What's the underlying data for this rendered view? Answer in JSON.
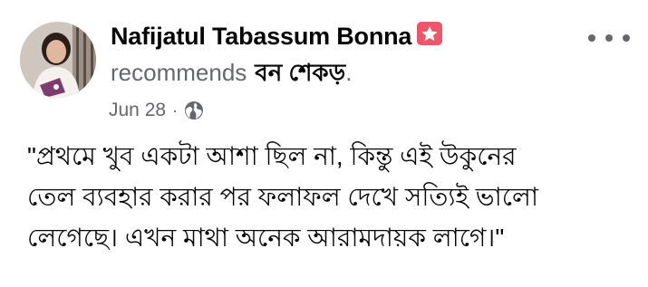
{
  "author": {
    "name": "Nafijatul Tabassum Bonna",
    "avatar": "profile-photo"
  },
  "recommendation": {
    "verb": "recommends",
    "page_name": "বন শেকড়",
    "period": "."
  },
  "meta": {
    "date": "Jun 28",
    "separator": "·",
    "privacy_icon": "globe-icon"
  },
  "more_icon": "more-options-icon",
  "badge_icon": "star-badge-icon",
  "colors": {
    "badge": "#f0566b",
    "secondary_text": "#65676b",
    "primary_text": "#050505"
  },
  "post_text_lines": [
    "\"প্রথমে খুব একটা আশা ছিল না, কিন্তু এই উকুনের",
    "তেল  ব্যবহার করার পর ফলাফল দেখে সত্যিই ভালো",
    "লেগেছে। এখন মাথা অনেক আরামদায়ক লাগে।\""
  ]
}
